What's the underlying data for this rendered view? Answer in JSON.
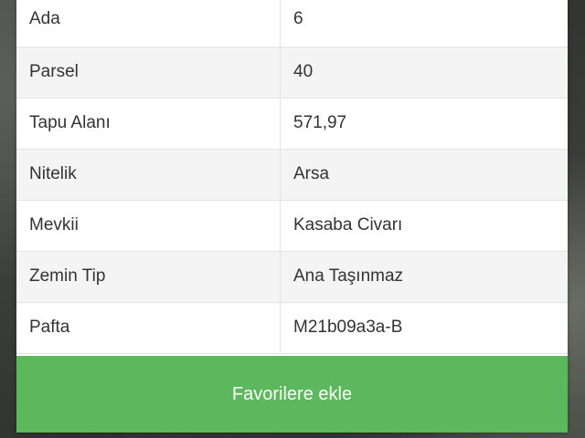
{
  "property_details": [
    {
      "label": "Ada",
      "value": "6"
    },
    {
      "label": "Parsel",
      "value": "40"
    },
    {
      "label": "Tapu Alanı",
      "value": "571,97"
    },
    {
      "label": "Nitelik",
      "value": "Arsa"
    },
    {
      "label": "Mevkii",
      "value": "Kasaba Civarı"
    },
    {
      "label": "Zemin Tip",
      "value": "Ana Taşınmaz"
    },
    {
      "label": "Pafta",
      "value": "M21b09a3a-B"
    }
  ],
  "actions": {
    "favorite_label": "Favorilere ekle",
    "favorite_color": "#5cb85c"
  }
}
